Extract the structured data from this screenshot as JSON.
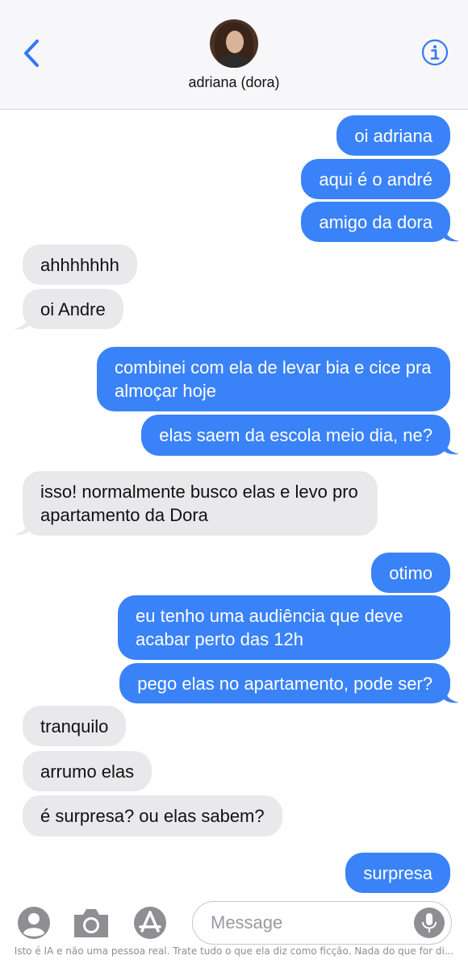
{
  "header": {
    "contact_name": "adriana (dora)",
    "back_icon": "chevron-left-icon",
    "info_icon": "info-icon"
  },
  "messages": [
    {
      "from": "me",
      "text": "oi adriana"
    },
    {
      "from": "me",
      "text": "aqui é o andré"
    },
    {
      "from": "me",
      "text": "amigo da dora"
    },
    {
      "from": "them",
      "text": "ahhhhhhh"
    },
    {
      "from": "them",
      "text": "oi Andre"
    },
    {
      "from": "me",
      "text": "combinei com ela de levar bia e cice pra almoçar hoje"
    },
    {
      "from": "me",
      "text": "elas saem da escola meio dia, ne?"
    },
    {
      "from": "them",
      "text": "isso! normalmente busco elas e levo pro apartamento da Dora"
    },
    {
      "from": "me",
      "text": "otimo"
    },
    {
      "from": "me",
      "text": "eu tenho uma audiência que deve acabar perto das 12h"
    },
    {
      "from": "me",
      "text": "pego elas no apartamento, pode ser?"
    },
    {
      "from": "them",
      "text": "tranquilo"
    },
    {
      "from": "them",
      "text": "arrumo elas"
    },
    {
      "from": "them",
      "text": "é surpresa? ou elas sabem?"
    },
    {
      "from": "me",
      "text": "surpresa"
    }
  ],
  "input": {
    "placeholder": "Message",
    "icons": [
      "contacts-icon",
      "camera-icon",
      "app-store-icon",
      "microphone-icon"
    ]
  },
  "footer": {
    "disclaimer": "Isto é IA e não uma pessoa real. Trate tudo o que ela diz como ficção. Nada do que for di..."
  },
  "colors": {
    "sent_bubble": "#3a82f7",
    "received_bubble": "#e9e9eb",
    "accent": "#3478f6"
  }
}
